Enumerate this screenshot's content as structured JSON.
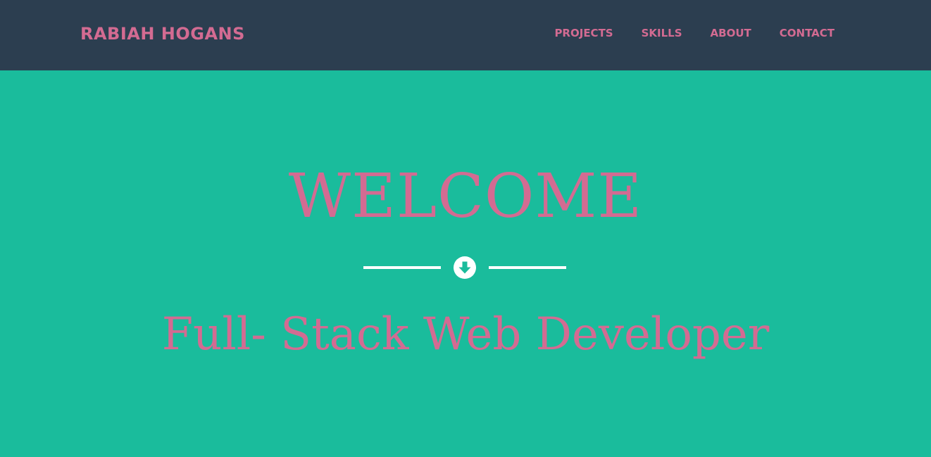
{
  "header": {
    "brand": "RABIAH HOGANS",
    "nav": [
      {
        "label": "PROJECTS"
      },
      {
        "label": "SKILLS"
      },
      {
        "label": "ABOUT"
      },
      {
        "label": "CONTACT"
      }
    ]
  },
  "hero": {
    "title": "WELCOME",
    "subtitle": "Full- Stack Web Developer",
    "divider_icon": "arrow-circle-down-icon"
  },
  "colors": {
    "navbar_bg": "#2c3e50",
    "hero_bg": "#1abc9c",
    "accent_pink": "#d36b92",
    "divider_white": "#ffffff"
  }
}
